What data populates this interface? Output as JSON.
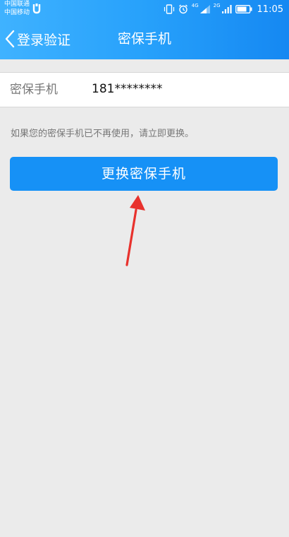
{
  "status_bar": {
    "carrier_1": "中国联通",
    "carrier_2": "中国移动",
    "network_1": "4G",
    "network_2": "2G",
    "time": "11:05",
    "icons": [
      "notification-icon",
      "vibrate-icon",
      "alarm-icon",
      "signal-icon",
      "battery-icon"
    ]
  },
  "nav": {
    "back_label": "登录验证",
    "title": "密保手机"
  },
  "phone_row": {
    "label": "密保手机",
    "value": "181********"
  },
  "hint": "如果您的密保手机已不再使用，请立即更换。",
  "change_button_label": "更换密保手机",
  "colors": {
    "header_start": "#3fb2ff",
    "header_end": "#1588f2",
    "button": "#1691f6",
    "background": "#ebebeb",
    "annotation_arrow": "#e8322d"
  }
}
